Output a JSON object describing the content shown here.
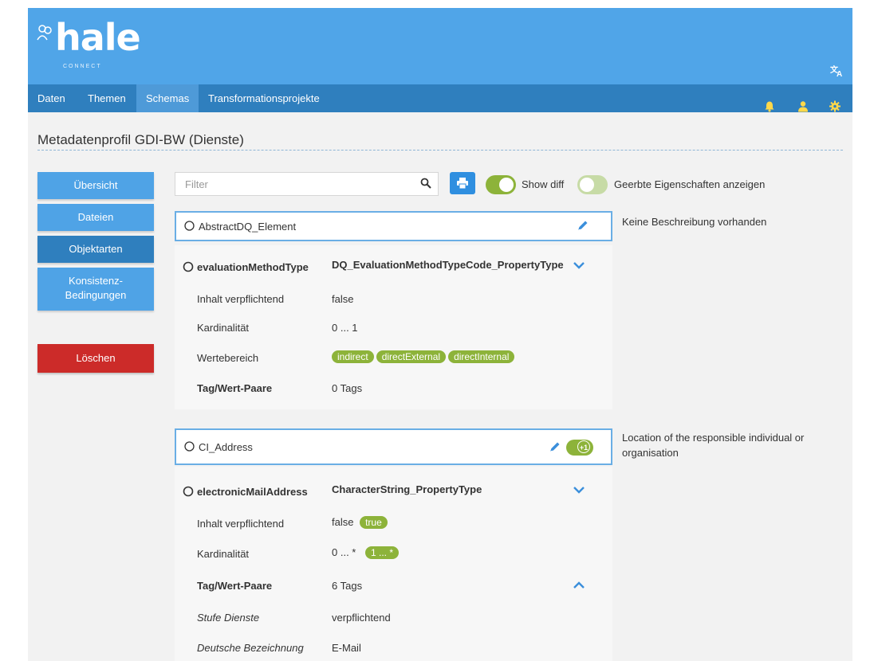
{
  "header": {
    "logo_text": "hale",
    "logo_sub": "CONNECT",
    "translate_icon": "translate-icon",
    "accent": "#50a5e8"
  },
  "nav": {
    "items": [
      "Daten",
      "Themen",
      "Schemas",
      "Transformationsprojekte"
    ],
    "active": "Schemas",
    "icons": [
      "bell-icon",
      "user-icon",
      "gear-icon"
    ]
  },
  "page": {
    "title": "Metadatenprofil GDI-BW (Dienste)"
  },
  "sidebar": {
    "items": [
      "Übersicht",
      "Dateien",
      "Objektarten",
      "Konsistenz-",
      "Bedingungen"
    ],
    "active": "Objektarten",
    "delete_label": "Löschen"
  },
  "toolbar": {
    "filter_placeholder": "Filter",
    "show_diff_label": "Show diff",
    "inherited_label": "Geerbte Eigenschaften anzeigen"
  },
  "cards": [
    {
      "name": "AbstractDQ_Element",
      "description": "Keine Beschreibung vorhanden",
      "property": {
        "name": "evaluationMethodType",
        "type": "DQ_EvaluationMethodTypeCode_PropertyType",
        "rows": {
          "mandatory_label": "Inhalt verpflichtend",
          "mandatory_value": "false",
          "cardinality_label": "Kardinalität",
          "cardinality_value": "0 ... 1",
          "range_label": "Wertebereich",
          "range_values": [
            "indirect",
            "directExternal",
            "directInternal"
          ],
          "tags_label": "Tag/Wert-Paare",
          "tags_value": "0 Tags"
        }
      }
    },
    {
      "name": "CI_Address",
      "badge": "+1",
      "description": "Location of the responsible individual or organisation",
      "property": {
        "name": "electronicMailAddress",
        "type": "CharacterString_PropertyType",
        "rows": {
          "mandatory_label": "Inhalt verpflichtend",
          "mandatory_value": "false",
          "mandatory_diff": "true",
          "cardinality_label": "Kardinalität",
          "cardinality_value": "0 ... *",
          "cardinality_diff": "1 ... *",
          "tags_label": "Tag/Wert-Paare",
          "tags_value": "6 Tags",
          "tag_rows": [
            {
              "key": "Stufe Dienste",
              "value": "verpflichtend"
            },
            {
              "key": "Deutsche Bezeichnung",
              "value": "E-Mail"
            }
          ]
        }
      }
    }
  ]
}
